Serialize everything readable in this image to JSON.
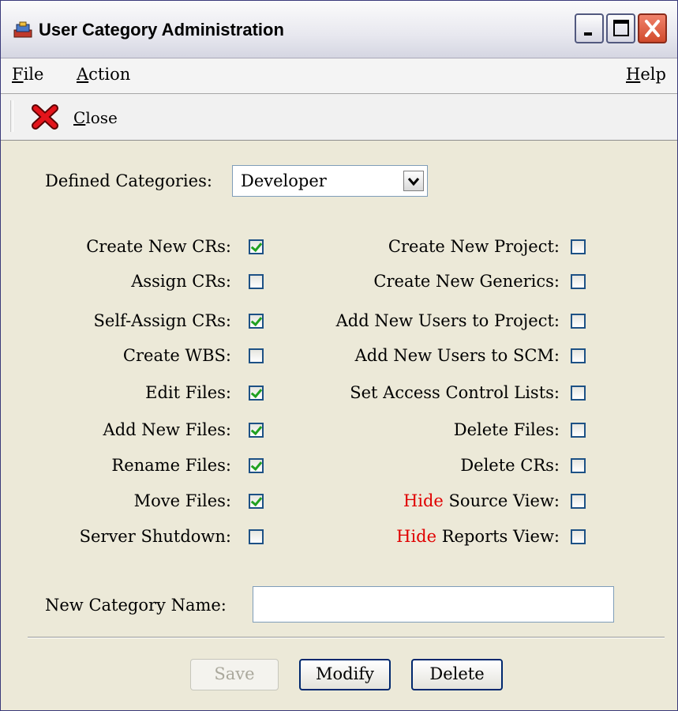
{
  "window": {
    "title": "User Category Administration"
  },
  "menu": {
    "file": "File",
    "action": "Action",
    "help": "Help"
  },
  "toolbar": {
    "close_label": "Close"
  },
  "form": {
    "defined_categories_label": "Defined Categories:",
    "defined_categories_value": "Developer",
    "left_permissions": [
      {
        "label": "Create New CRs:",
        "checked": true
      },
      {
        "label": "Assign CRs:",
        "checked": false
      },
      {
        "label": "Self-Assign CRs:",
        "checked": true
      },
      {
        "label": "Create WBS:",
        "checked": false
      },
      {
        "label": "Edit Files:",
        "checked": true
      },
      {
        "label": "Add New Files:",
        "checked": true
      },
      {
        "label": "Rename Files:",
        "checked": true
      },
      {
        "label": "Move Files:",
        "checked": true
      },
      {
        "label": "Server Shutdown:",
        "checked": false
      }
    ],
    "right_permissions": [
      {
        "label": "Create New Project:",
        "checked": false
      },
      {
        "label": "Create New Generics:",
        "checked": false
      },
      {
        "label": "Add New Users to Project:",
        "checked": false
      },
      {
        "label": "Add New Users to SCM:",
        "checked": false
      },
      {
        "label": "Set Access Control Lists:",
        "checked": false
      },
      {
        "label": "Delete Files:",
        "checked": false
      },
      {
        "label": "Delete CRs:",
        "checked": false
      },
      {
        "label": "Source View:",
        "prefix": "Hide",
        "checked": false
      },
      {
        "label": "Reports View:",
        "prefix": "Hide",
        "checked": false
      }
    ],
    "new_category_label": "New Category Name:",
    "new_category_value": ""
  },
  "buttons": {
    "save": "Save",
    "modify": "Modify",
    "delete": "Delete"
  },
  "colors": {
    "hide_prefix": "#e00000",
    "check": "#21a121",
    "checkbox_border": "#1d5185"
  }
}
